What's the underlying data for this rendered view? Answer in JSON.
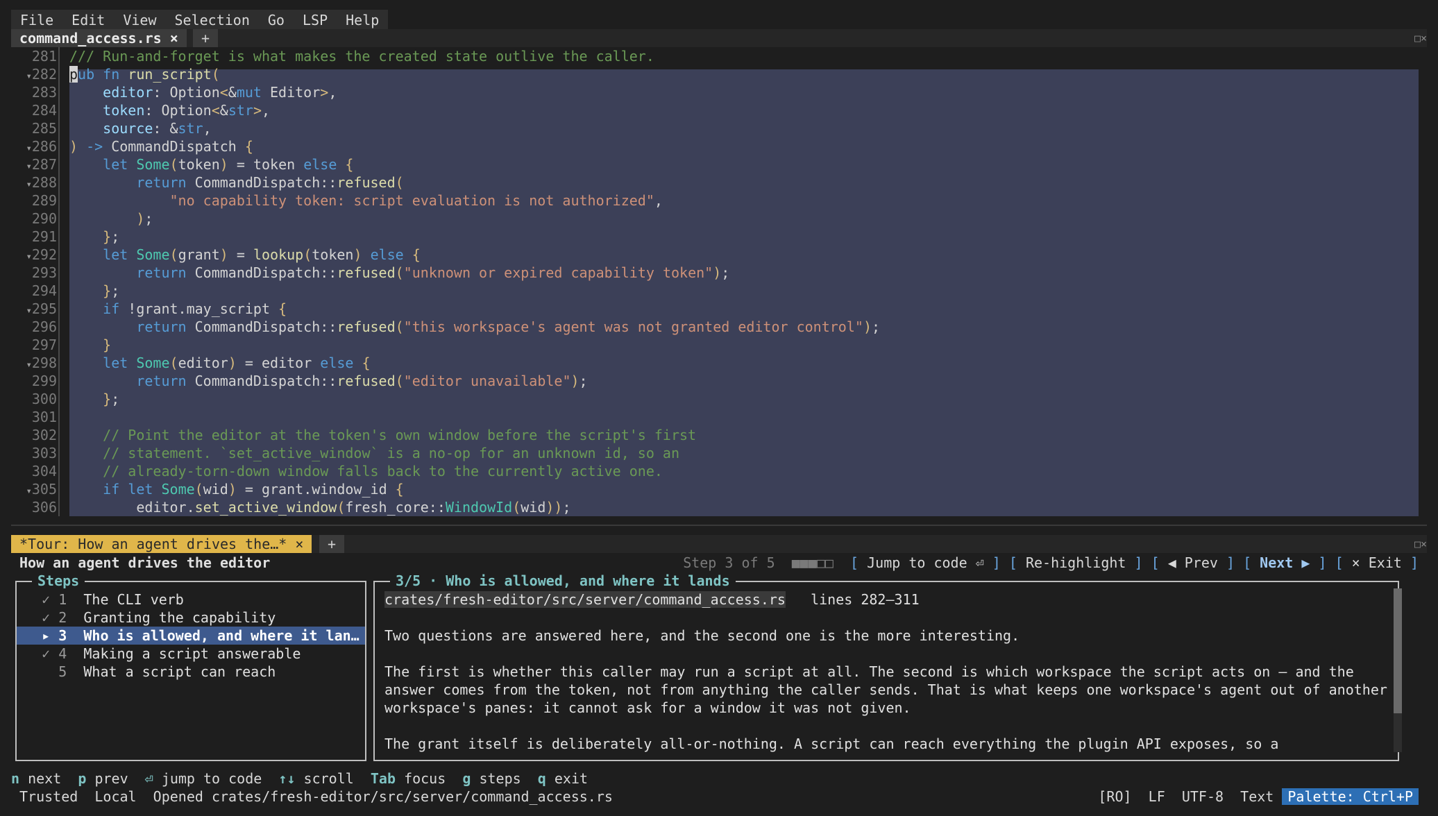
{
  "menu": [
    "File",
    "Edit",
    "View",
    "Selection",
    "Go",
    "LSP",
    "Help"
  ],
  "editor_tab": {
    "label": "command_access.rs ×",
    "add": "+",
    "corner": "□×"
  },
  "code_lines": [
    {
      "n": "281",
      "fold": "",
      "tokens": [
        [
          "cm",
          "/// Run-and-forget is what makes the created state outlive the caller."
        ]
      ]
    },
    {
      "n": "282",
      "fold": "▾",
      "tokens": [
        [
          "cursor",
          "p"
        ],
        [
          "kw",
          "ub fn "
        ],
        [
          "fn",
          "run_script"
        ],
        [
          "br",
          "("
        ]
      ]
    },
    {
      "n": "283",
      "fold": "",
      "tokens": [
        [
          "",
          "    "
        ],
        [
          "var",
          "editor"
        ],
        [
          "",
          ": Option"
        ],
        [
          "br",
          "<"
        ],
        [
          "",
          "&"
        ],
        [
          "kw",
          "mut"
        ],
        [
          "",
          " Editor"
        ],
        [
          "br",
          ">"
        ],
        [
          "",
          ","
        ]
      ]
    },
    {
      "n": "284",
      "fold": "",
      "tokens": [
        [
          "",
          "    "
        ],
        [
          "var",
          "token"
        ],
        [
          "",
          ": Option"
        ],
        [
          "br",
          "<"
        ],
        [
          "",
          "&"
        ],
        [
          "kw",
          "str"
        ],
        [
          "br",
          ">"
        ],
        [
          "",
          ","
        ]
      ]
    },
    {
      "n": "285",
      "fold": "",
      "tokens": [
        [
          "",
          "    "
        ],
        [
          "var",
          "source"
        ],
        [
          "",
          ": &"
        ],
        [
          "kw",
          "str"
        ],
        [
          "",
          ","
        ]
      ]
    },
    {
      "n": "286",
      "fold": "▾",
      "tokens": [
        [
          "br",
          ")"
        ],
        [
          "",
          " "
        ],
        [
          "kw",
          "->"
        ],
        [
          "",
          " CommandDispatch "
        ],
        [
          "br",
          "{"
        ]
      ]
    },
    {
      "n": "287",
      "fold": "▾",
      "tokens": [
        [
          "",
          "    "
        ],
        [
          "kw",
          "let"
        ],
        [
          "",
          " "
        ],
        [
          "ty",
          "Some"
        ],
        [
          "br",
          "("
        ],
        [
          "",
          "token"
        ],
        [
          "br",
          ")"
        ],
        [
          "",
          " = token "
        ],
        [
          "kw",
          "else"
        ],
        [
          "",
          " "
        ],
        [
          "br",
          "{"
        ]
      ]
    },
    {
      "n": "288",
      "fold": "▾",
      "tokens": [
        [
          "",
          "        "
        ],
        [
          "kw",
          "return"
        ],
        [
          "",
          " CommandDispatch::"
        ],
        [
          "fn",
          "refused"
        ],
        [
          "br",
          "("
        ]
      ]
    },
    {
      "n": "289",
      "fold": "",
      "tokens": [
        [
          "",
          "            "
        ],
        [
          "str",
          "\"no capability token: script evaluation is not authorized\""
        ],
        [
          "",
          ","
        ]
      ]
    },
    {
      "n": "290",
      "fold": "",
      "tokens": [
        [
          "",
          "        "
        ],
        [
          "br",
          ")"
        ],
        [
          "",
          ";"
        ]
      ]
    },
    {
      "n": "291",
      "fold": "",
      "tokens": [
        [
          "",
          "    "
        ],
        [
          "br",
          "}"
        ],
        [
          "",
          ";"
        ]
      ]
    },
    {
      "n": "292",
      "fold": "▾",
      "tokens": [
        [
          "",
          "    "
        ],
        [
          "kw",
          "let"
        ],
        [
          "",
          " "
        ],
        [
          "ty",
          "Some"
        ],
        [
          "br",
          "("
        ],
        [
          "",
          "grant"
        ],
        [
          "br",
          ")"
        ],
        [
          "",
          " = "
        ],
        [
          "fn",
          "lookup"
        ],
        [
          "br",
          "("
        ],
        [
          "",
          "token"
        ],
        [
          "br",
          ")"
        ],
        [
          "",
          " "
        ],
        [
          "kw",
          "else"
        ],
        [
          "",
          " "
        ],
        [
          "br",
          "{"
        ]
      ]
    },
    {
      "n": "293",
      "fold": "",
      "tokens": [
        [
          "",
          "        "
        ],
        [
          "kw",
          "return"
        ],
        [
          "",
          " CommandDispatch::"
        ],
        [
          "fn",
          "refused"
        ],
        [
          "br",
          "("
        ],
        [
          "str",
          "\"unknown or expired capability token\""
        ],
        [
          "br",
          ")"
        ],
        [
          "",
          ";"
        ]
      ]
    },
    {
      "n": "294",
      "fold": "",
      "tokens": [
        [
          "",
          "    "
        ],
        [
          "br",
          "}"
        ],
        [
          "",
          ";"
        ]
      ]
    },
    {
      "n": "295",
      "fold": "▾",
      "tokens": [
        [
          "",
          "    "
        ],
        [
          "kw",
          "if"
        ],
        [
          "",
          " !grant.may_script "
        ],
        [
          "br",
          "{"
        ]
      ]
    },
    {
      "n": "296",
      "fold": "",
      "tokens": [
        [
          "",
          "        "
        ],
        [
          "kw",
          "return"
        ],
        [
          "",
          " CommandDispatch::"
        ],
        [
          "fn",
          "refused"
        ],
        [
          "br",
          "("
        ],
        [
          "str",
          "\"this workspace's agent was not granted editor control\""
        ],
        [
          "br",
          ")"
        ],
        [
          "",
          ";"
        ]
      ]
    },
    {
      "n": "297",
      "fold": "",
      "tokens": [
        [
          "",
          "    "
        ],
        [
          "br",
          "}"
        ]
      ]
    },
    {
      "n": "298",
      "fold": "▾",
      "tokens": [
        [
          "",
          "    "
        ],
        [
          "kw",
          "let"
        ],
        [
          "",
          " "
        ],
        [
          "ty",
          "Some"
        ],
        [
          "br",
          "("
        ],
        [
          "",
          "editor"
        ],
        [
          "br",
          ")"
        ],
        [
          "",
          " = editor "
        ],
        [
          "kw",
          "else"
        ],
        [
          "",
          " "
        ],
        [
          "br",
          "{"
        ]
      ]
    },
    {
      "n": "299",
      "fold": "",
      "tokens": [
        [
          "",
          "        "
        ],
        [
          "kw",
          "return"
        ],
        [
          "",
          " CommandDispatch::"
        ],
        [
          "fn",
          "refused"
        ],
        [
          "br",
          "("
        ],
        [
          "str",
          "\"editor unavailable\""
        ],
        [
          "br",
          ")"
        ],
        [
          "",
          ";"
        ]
      ]
    },
    {
      "n": "300",
      "fold": "",
      "tokens": [
        [
          "",
          "    "
        ],
        [
          "br",
          "}"
        ],
        [
          "",
          ";"
        ]
      ]
    },
    {
      "n": "301",
      "fold": "",
      "tokens": []
    },
    {
      "n": "302",
      "fold": "",
      "tokens": [
        [
          "",
          "    "
        ],
        [
          "cm",
          "// Point the editor at the token's own window before the script's first"
        ]
      ]
    },
    {
      "n": "303",
      "fold": "",
      "tokens": [
        [
          "",
          "    "
        ],
        [
          "cm",
          "// statement. `set_active_window` is a no-op for an unknown id, so an"
        ]
      ]
    },
    {
      "n": "304",
      "fold": "",
      "tokens": [
        [
          "",
          "    "
        ],
        [
          "cm",
          "// already-torn-down window falls back to the currently active one."
        ]
      ]
    },
    {
      "n": "305",
      "fold": "▾",
      "tokens": [
        [
          "",
          "    "
        ],
        [
          "kw",
          "if"
        ],
        [
          "",
          " "
        ],
        [
          "kw",
          "let"
        ],
        [
          "",
          " "
        ],
        [
          "ty",
          "Some"
        ],
        [
          "br",
          "("
        ],
        [
          "",
          "wid"
        ],
        [
          "br",
          ")"
        ],
        [
          "",
          " = grant.window_id "
        ],
        [
          "br",
          "{"
        ]
      ]
    },
    {
      "n": "306",
      "fold": "",
      "tokens": [
        [
          "",
          "        "
        ],
        [
          "",
          "editor."
        ],
        [
          "fn",
          "set_active_window"
        ],
        [
          "br",
          "("
        ],
        [
          "",
          "fresh_core::"
        ],
        [
          "ty",
          "WindowId"
        ],
        [
          "br",
          "("
        ],
        [
          "",
          "wid"
        ],
        [
          "br",
          "))"
        ],
        [
          "",
          ";"
        ]
      ]
    }
  ],
  "tour_tab": {
    "label": "*Tour: How an agent drives the…* ×",
    "add": "+",
    "corner": "□×"
  },
  "tour": {
    "title": "How an agent drives the editor",
    "step_label": "Step 3 of 5",
    "progress_glyphs": "■■■□□",
    "jump": "Jump to code ⏎",
    "rehighlight": "Re-highlight",
    "prev": "◀ Prev",
    "next": "Next ▶",
    "exit": "× Exit",
    "steps_title": "Steps",
    "steps": [
      {
        "mark": "✓",
        "num": "1",
        "label": "The CLI verb",
        "selected": false
      },
      {
        "mark": "✓",
        "num": "2",
        "label": "Granting the capability",
        "selected": false
      },
      {
        "mark": "▸",
        "num": "3",
        "label": "Who is allowed, and where it lan…",
        "selected": true
      },
      {
        "mark": "✓",
        "num": "4",
        "label": "Making a script answerable",
        "selected": false
      },
      {
        "mark": "",
        "num": "5",
        "label": "What a script can reach",
        "selected": false
      }
    ],
    "detail_title": "3/5 · Who is allowed, and where it lands",
    "detail_path": "crates/fresh-editor/src/server/command_access.rs",
    "detail_lines_ref": "lines 282–311",
    "detail_body": [
      "",
      "Two questions are answered here, and the second one is the more interesting.",
      "",
      "The first is whether this caller may run a script at all. The second is which workspace the script acts on — and the",
      "answer comes from the token, not from anything the caller sends. That is what keeps one workspace's agent out of another",
      "workspace's panes: it cannot ask for a window it was not given.",
      "",
      "The grant itself is deliberately all-or-nothing. A script can reach everything the plugin API exposes, so a"
    ]
  },
  "hints": [
    {
      "key": "n",
      "text": "next"
    },
    {
      "key": "p",
      "text": "prev"
    },
    {
      "key": "⏎",
      "text": "jump to code"
    },
    {
      "key": "↑↓",
      "text": "scroll"
    },
    {
      "key": "Tab",
      "text": "focus"
    },
    {
      "key": "g",
      "text": "steps"
    },
    {
      "key": "q",
      "text": "exit"
    }
  ],
  "status": {
    "left": "Trusted  Local  Opened crates/fresh-editor/src/server/command_access.rs",
    "ro": "[RO]",
    "eol": "LF",
    "enc": "UTF-8",
    "mode": "Text",
    "palette": "Palette: Ctrl+P"
  }
}
